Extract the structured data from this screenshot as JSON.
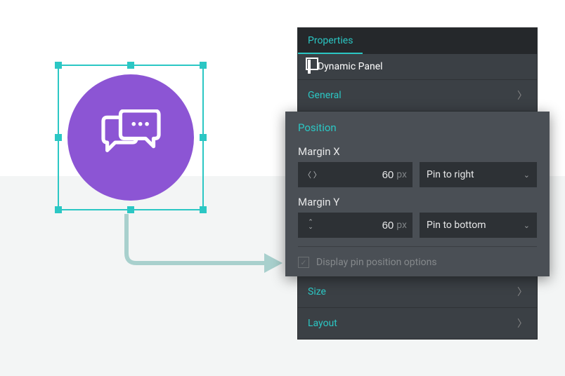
{
  "panel": {
    "tab": "Properties",
    "element_name": "Dynamic Panel",
    "sections": {
      "general": "General",
      "position": "Position",
      "size": "Size",
      "layout": "Layout"
    },
    "position": {
      "margin_x_label": "Margin X",
      "margin_x_value": "60",
      "margin_x_unit": "px",
      "margin_x_pin": "Pin to right",
      "margin_y_label": "Margin Y",
      "margin_y_value": "60",
      "margin_y_unit": "px",
      "margin_y_pin": "Pin to bottom",
      "display_options_label": "Display pin position options",
      "display_options_checked": true
    }
  },
  "canvas": {
    "selected": "chat-icon"
  }
}
